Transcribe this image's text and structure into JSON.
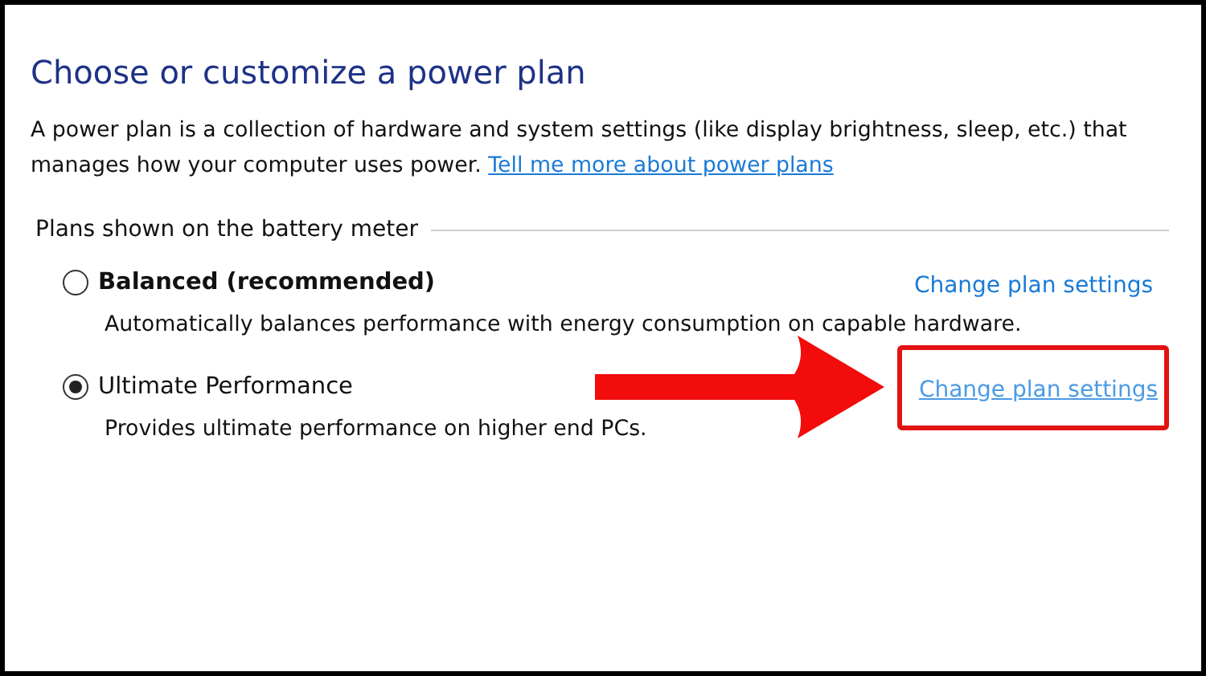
{
  "title": "Choose or customize a power plan",
  "intro": {
    "text": "A power plan is a collection of hardware and system settings (like display brightness, sleep, etc.) that manages how your computer uses power.",
    "link": "Tell me more about power plans"
  },
  "group_label": "Plans shown on the battery meter",
  "plans": [
    {
      "name": "Balanced (recommended)",
      "bold": true,
      "selected": false,
      "description": "Automatically balances performance with energy consumption on capable hardware.",
      "link": "Change plan settings",
      "link_hovered": false,
      "highlighted": false
    },
    {
      "name": "Ultimate Performance",
      "bold": false,
      "selected": true,
      "description": "Provides ultimate performance on higher end PCs.",
      "link": "Change plan settings",
      "link_hovered": true,
      "highlighted": true
    }
  ]
}
